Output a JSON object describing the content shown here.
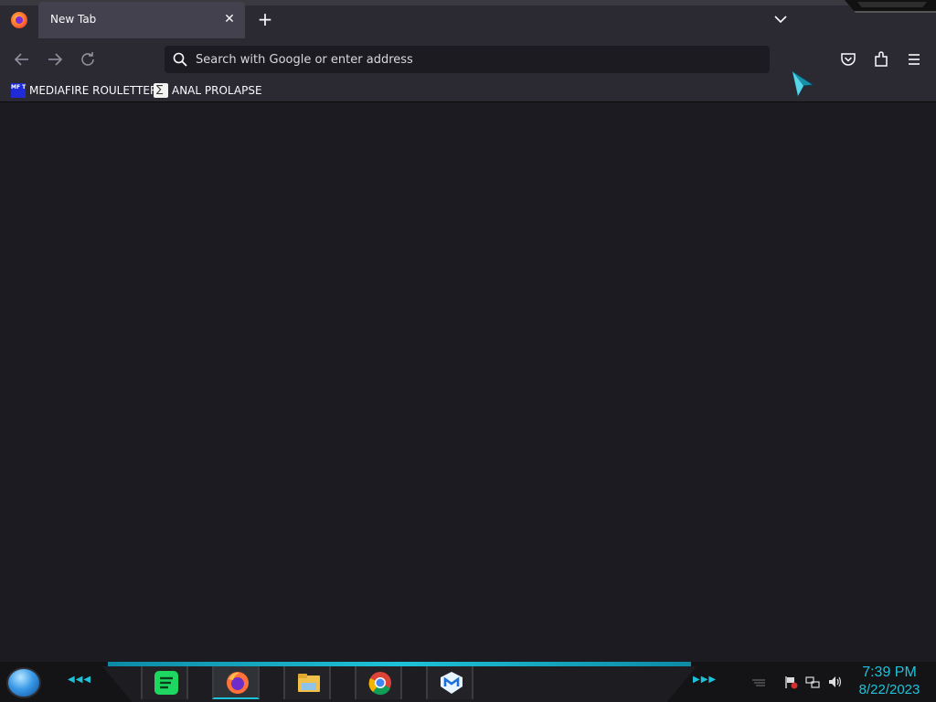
{
  "browser": {
    "tabs": [
      {
        "title": "New Tab",
        "active": true
      }
    ],
    "new_tab_label": "+",
    "close_tab_label": "✕",
    "urlbar": {
      "placeholder": "Search with Google or enter address",
      "value": ""
    },
    "bookmarks": [
      {
        "label": "MEDIAFIRE ROULETTER",
        "icon": "mediafire-favicon",
        "icon_text": "MF T"
      },
      {
        "label": "ANAL PROLAPSE",
        "icon": "generic-favicon"
      }
    ],
    "toolbar_icons": [
      "back-icon",
      "forward-icon",
      "reload-icon",
      "pocket-icon",
      "extensions-icon",
      "menu-icon"
    ]
  },
  "taskbar": {
    "pinned_apps": [
      {
        "name": "Spotify",
        "icon": "spotify-icon",
        "active": false
      },
      {
        "name": "Firefox",
        "icon": "firefox-icon",
        "active": true
      },
      {
        "name": "File Explorer",
        "icon": "file-explorer-icon",
        "active": false
      },
      {
        "name": "Google Chrome",
        "icon": "chrome-icon",
        "active": false
      },
      {
        "name": "Malwarebytes",
        "icon": "malwarebytes-icon",
        "active": false
      }
    ],
    "tray_icons": [
      "action-center-flag-icon",
      "network-icon",
      "volume-icon"
    ],
    "clock": {
      "time": "7:39 PM",
      "date": "8/22/2023"
    }
  },
  "colors": {
    "toolbar_bg": "#2b2a33",
    "content_bg": "#1c1b22",
    "tab_active_bg": "#42414d",
    "accent": "#1ec2d8",
    "text": "#fbfbfe"
  }
}
